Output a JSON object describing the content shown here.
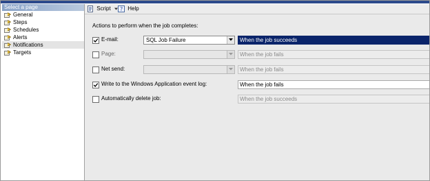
{
  "sidebar": {
    "header": "Select a page",
    "items": [
      {
        "label": "General"
      },
      {
        "label": "Steps"
      },
      {
        "label": "Schedules"
      },
      {
        "label": "Alerts"
      },
      {
        "label": "Notifications",
        "selected": true
      },
      {
        "label": "Targets"
      }
    ]
  },
  "toolbar": {
    "script_label": "Script",
    "help_label": "Help"
  },
  "main": {
    "section_title": "Actions to perform when the job completes:",
    "email": {
      "checked": true,
      "label": "E-mail:",
      "operator": "SQL Job Failure",
      "when": "When the job succeeds"
    },
    "page": {
      "checked": false,
      "label": "Page:",
      "operator": "",
      "when": "When the job fails"
    },
    "net_send": {
      "checked": false,
      "label": "Net send:",
      "operator": "",
      "when": "When the job fails"
    },
    "event_log": {
      "checked": true,
      "label": "Write to the Windows Application event log:",
      "when": "When the job fails"
    },
    "delete_job": {
      "checked": false,
      "label": "Automatically delete job:",
      "when": "When the job succeeds"
    }
  },
  "colors": {
    "title_bar": "#2c4a8c",
    "selection": "#0a246a",
    "panel_bg": "#eaeaea"
  }
}
